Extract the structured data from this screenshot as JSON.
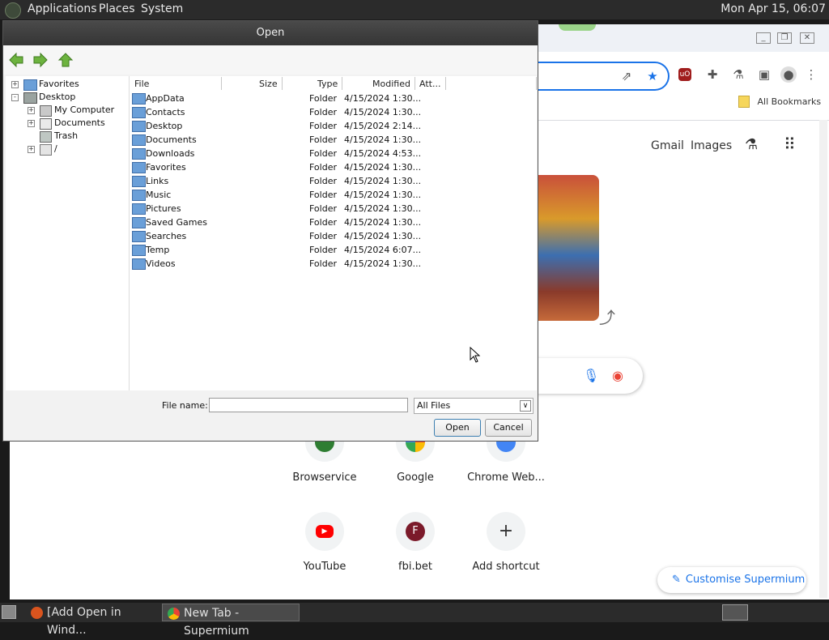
{
  "top_panel": {
    "menus": [
      "Applications",
      "Places",
      "System"
    ],
    "clock": "Mon Apr 15, 06:07"
  },
  "bottom_panel": {
    "tasks": [
      "[Add Open in Wind...",
      "New Tab - Supermium"
    ]
  },
  "browser": {
    "bookmarks_bar_label": "All Bookmarks",
    "google_links": [
      "Gmail",
      "Images"
    ],
    "shortcuts": [
      {
        "label": "Browservice",
        "letter": ""
      },
      {
        "label": "Google",
        "letter": ""
      },
      {
        "label": "Chrome Web...",
        "letter": ""
      },
      {
        "label": "YouTube",
        "letter": ""
      },
      {
        "label": "fbi.bet",
        "letter": "F"
      },
      {
        "label": "Add shortcut",
        "letter": "+"
      }
    ],
    "customise_label": "Customise Supermium",
    "extension_icons": [
      "share-icon",
      "star-icon",
      "ublock-icon",
      "puzzle-icon",
      "flask-icon",
      "sidepanel-icon",
      "profile-icon",
      "menu-icon"
    ]
  },
  "dialog": {
    "title": "Open",
    "tree": [
      {
        "label": "Favorites",
        "expander": "+",
        "icon": "folder-icon",
        "level": 0
      },
      {
        "label": "Desktop",
        "expander": "-",
        "icon": "desktop-icon",
        "level": 0
      },
      {
        "label": "My Computer",
        "expander": "+",
        "icon": "computer-icon",
        "level": 1
      },
      {
        "label": "Documents",
        "expander": "+",
        "icon": "documents-icon",
        "level": 1
      },
      {
        "label": "Trash",
        "expander": "",
        "icon": "trash-icon",
        "level": 1
      },
      {
        "label": "/",
        "expander": "+",
        "icon": "drive-icon",
        "level": 1
      }
    ],
    "columns": [
      "File",
      "Size",
      "Type",
      "Modified",
      "Att..."
    ],
    "files": [
      {
        "name": "AppData",
        "type": "Folder",
        "modified": "4/15/2024 1:30..."
      },
      {
        "name": "Contacts",
        "type": "Folder",
        "modified": "4/15/2024 1:30..."
      },
      {
        "name": "Desktop",
        "type": "Folder",
        "modified": "4/15/2024 2:14..."
      },
      {
        "name": "Documents",
        "type": "Folder",
        "modified": "4/15/2024 1:30..."
      },
      {
        "name": "Downloads",
        "type": "Folder",
        "modified": "4/15/2024 4:53..."
      },
      {
        "name": "Favorites",
        "type": "Folder",
        "modified": "4/15/2024 1:30..."
      },
      {
        "name": "Links",
        "type": "Folder",
        "modified": "4/15/2024 1:30..."
      },
      {
        "name": "Music",
        "type": "Folder",
        "modified": "4/15/2024 1:30..."
      },
      {
        "name": "Pictures",
        "type": "Folder",
        "modified": "4/15/2024 1:30..."
      },
      {
        "name": "Saved Games",
        "type": "Folder",
        "modified": "4/15/2024 1:30..."
      },
      {
        "name": "Searches",
        "type": "Folder",
        "modified": "4/15/2024 1:30..."
      },
      {
        "name": "Temp",
        "type": "Folder",
        "modified": "4/15/2024 6:07..."
      },
      {
        "name": "Videos",
        "type": "Folder",
        "modified": "4/15/2024 1:30..."
      }
    ],
    "filename_label": "File name:",
    "filename_value": "",
    "filter_value": "All Files",
    "open_label": "Open",
    "cancel_label": "Cancel"
  },
  "colors": {
    "panel_bg": "#2b2b2b",
    "dialog_title_bg": "#3f3f3f",
    "accent": "#1a73e8",
    "nav_arrow_green": "#5aa02c",
    "folder_blue": "#6a9fd8"
  }
}
